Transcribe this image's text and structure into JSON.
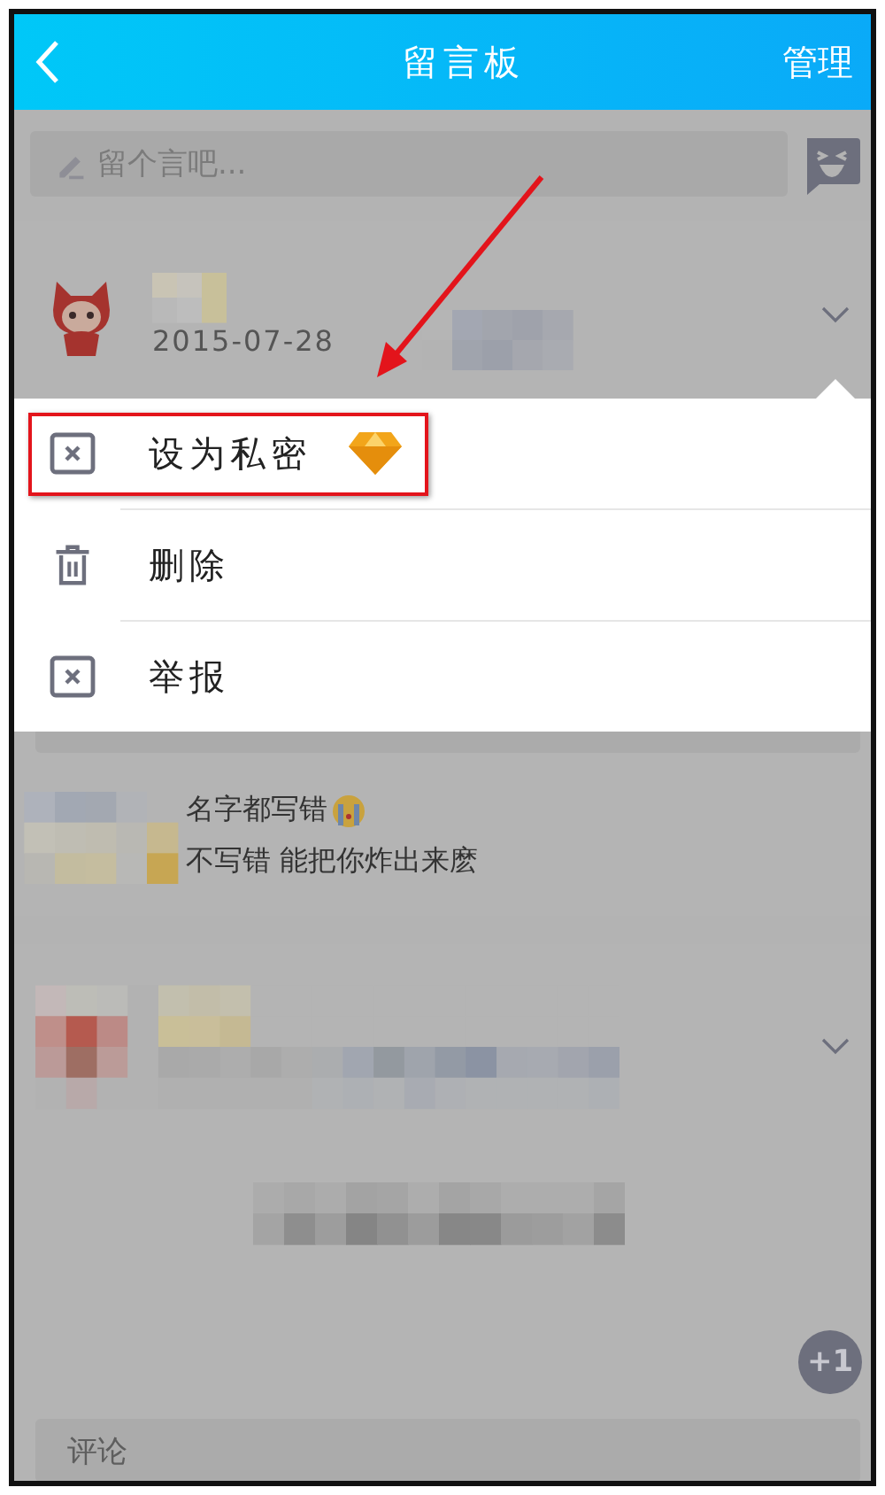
{
  "header": {
    "title": "留言板",
    "action": "管理"
  },
  "composer": {
    "placeholder": "留个言吧..."
  },
  "posts": [
    {
      "date": "2015-07-28",
      "replies": [
        {
          "text": "名字都写错",
          "emoji": true
        },
        {
          "text": "不写错 能把你炸出来麽",
          "emoji": false
        }
      ]
    },
    {
      "comment_placeholder": "评论"
    }
  ],
  "like_button": "+1",
  "menu": {
    "items": [
      {
        "kind": "private",
        "label": "设为私密",
        "highlighted": true
      },
      {
        "kind": "delete",
        "label": "删除",
        "highlighted": false
      },
      {
        "kind": "report",
        "label": "举报",
        "highlighted": false
      }
    ]
  }
}
